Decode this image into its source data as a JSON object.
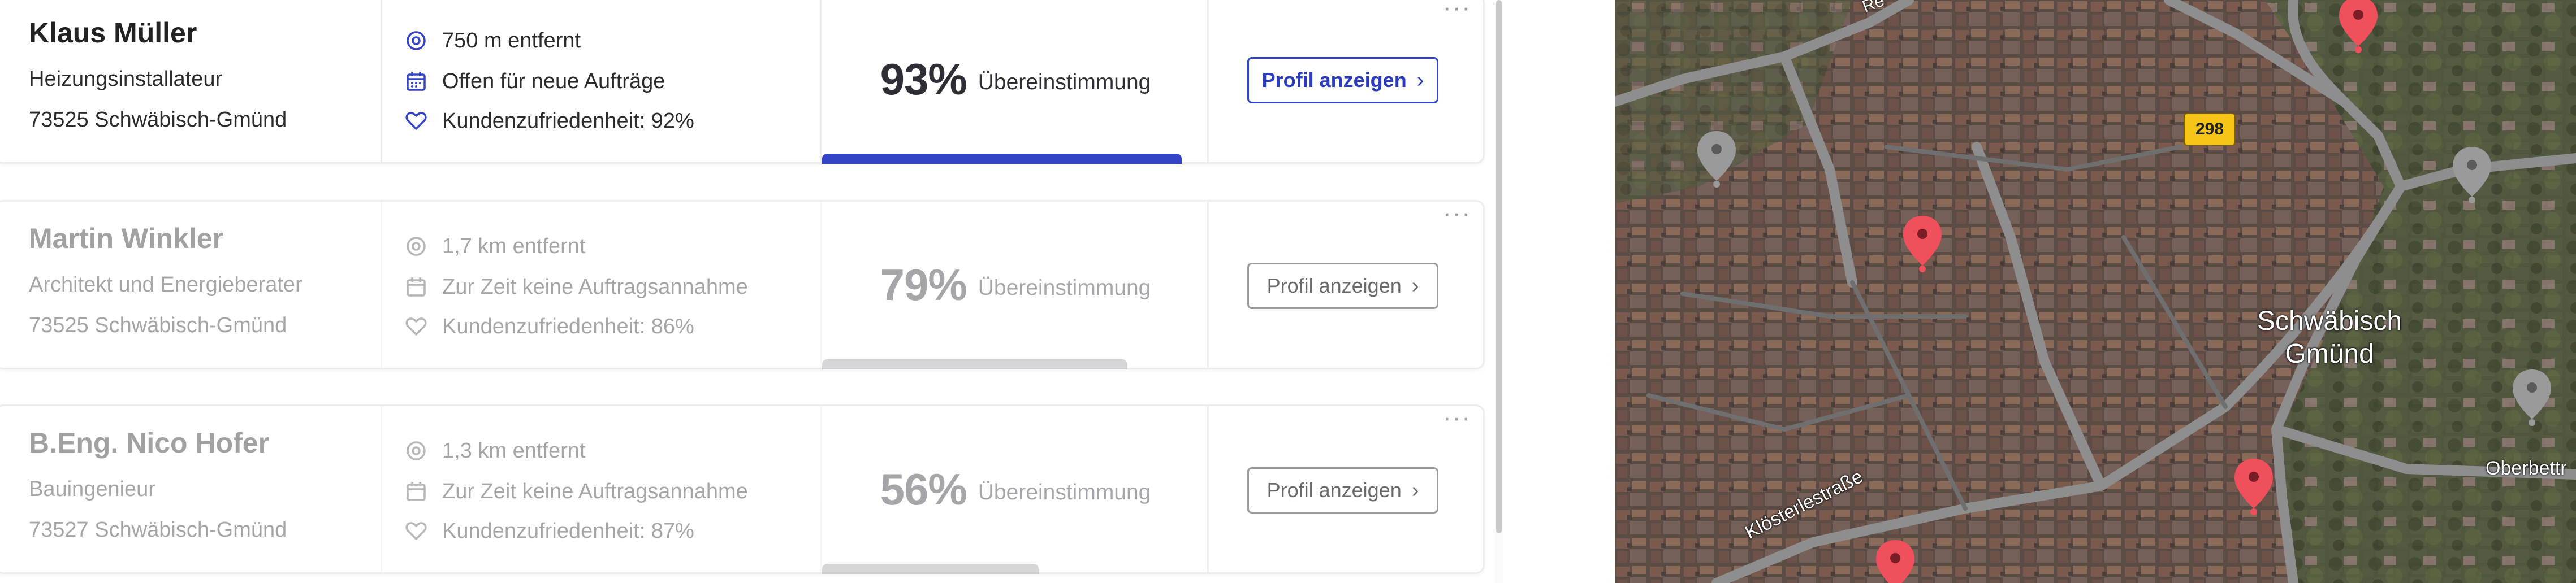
{
  "results": [
    {
      "name": "Klaus Müller",
      "profession": "Heizungsinstallateur",
      "address": "73525 Schwäbisch-Gmünd",
      "distance": "750 m entfernt",
      "availability": "Offen für neue Aufträge",
      "satisfaction": "Kundenzufriedenheit: 92%",
      "match_pct": "93%",
      "match_label": "Übereinstimmung",
      "match_value": 0.93,
      "button": "Profil anzeigen",
      "more": "···",
      "active": true
    },
    {
      "name": "Martin Winkler",
      "profession": "Architekt und Energieberater",
      "address": "73525 Schwäbisch-Gmünd",
      "distance": "1,7 km entfernt",
      "availability": "Zur Zeit keine Auftragsannahme",
      "satisfaction": "Kundenzufriedenheit: 86%",
      "match_pct": "79%",
      "match_label": "Übereinstimmung",
      "match_value": 0.79,
      "button": "Profil anzeigen",
      "more": "···",
      "active": false
    },
    {
      "name": "B.Eng. Nico Hofer",
      "profession": "Bauingenieur",
      "address": "73527 Schwäbisch-Gmünd",
      "distance": "1,3 km entfernt",
      "availability": "Zur Zeit keine Auftragsannahme",
      "satisfaction": "Kundenzufriedenheit: 87%",
      "match_pct": "56%",
      "match_label": "Übereinstimmung",
      "match_value": 0.56,
      "button": "Profil anzeigen",
      "more": "···",
      "active": false
    }
  ],
  "icons": {
    "distance": "location-target-icon",
    "availability": "calendar-icon",
    "satisfaction": "heart-icon",
    "button_chevron": "chevron-right-icon",
    "more": "more-options-icon"
  },
  "colors": {
    "accent": "#3343c6",
    "bar_active": "#3344c4",
    "bar_inactive": "#9e9ea4",
    "pin_active": "#f0505c",
    "pin_inactive": "#9a9a9a"
  },
  "map": {
    "city_line1": "Schwäbisch",
    "city_line2": "Gmünd",
    "road_number": "298",
    "street_kloster": "Klösterlestraße",
    "street_oberbett": "Oberbettr",
    "street_top": "Re"
  }
}
